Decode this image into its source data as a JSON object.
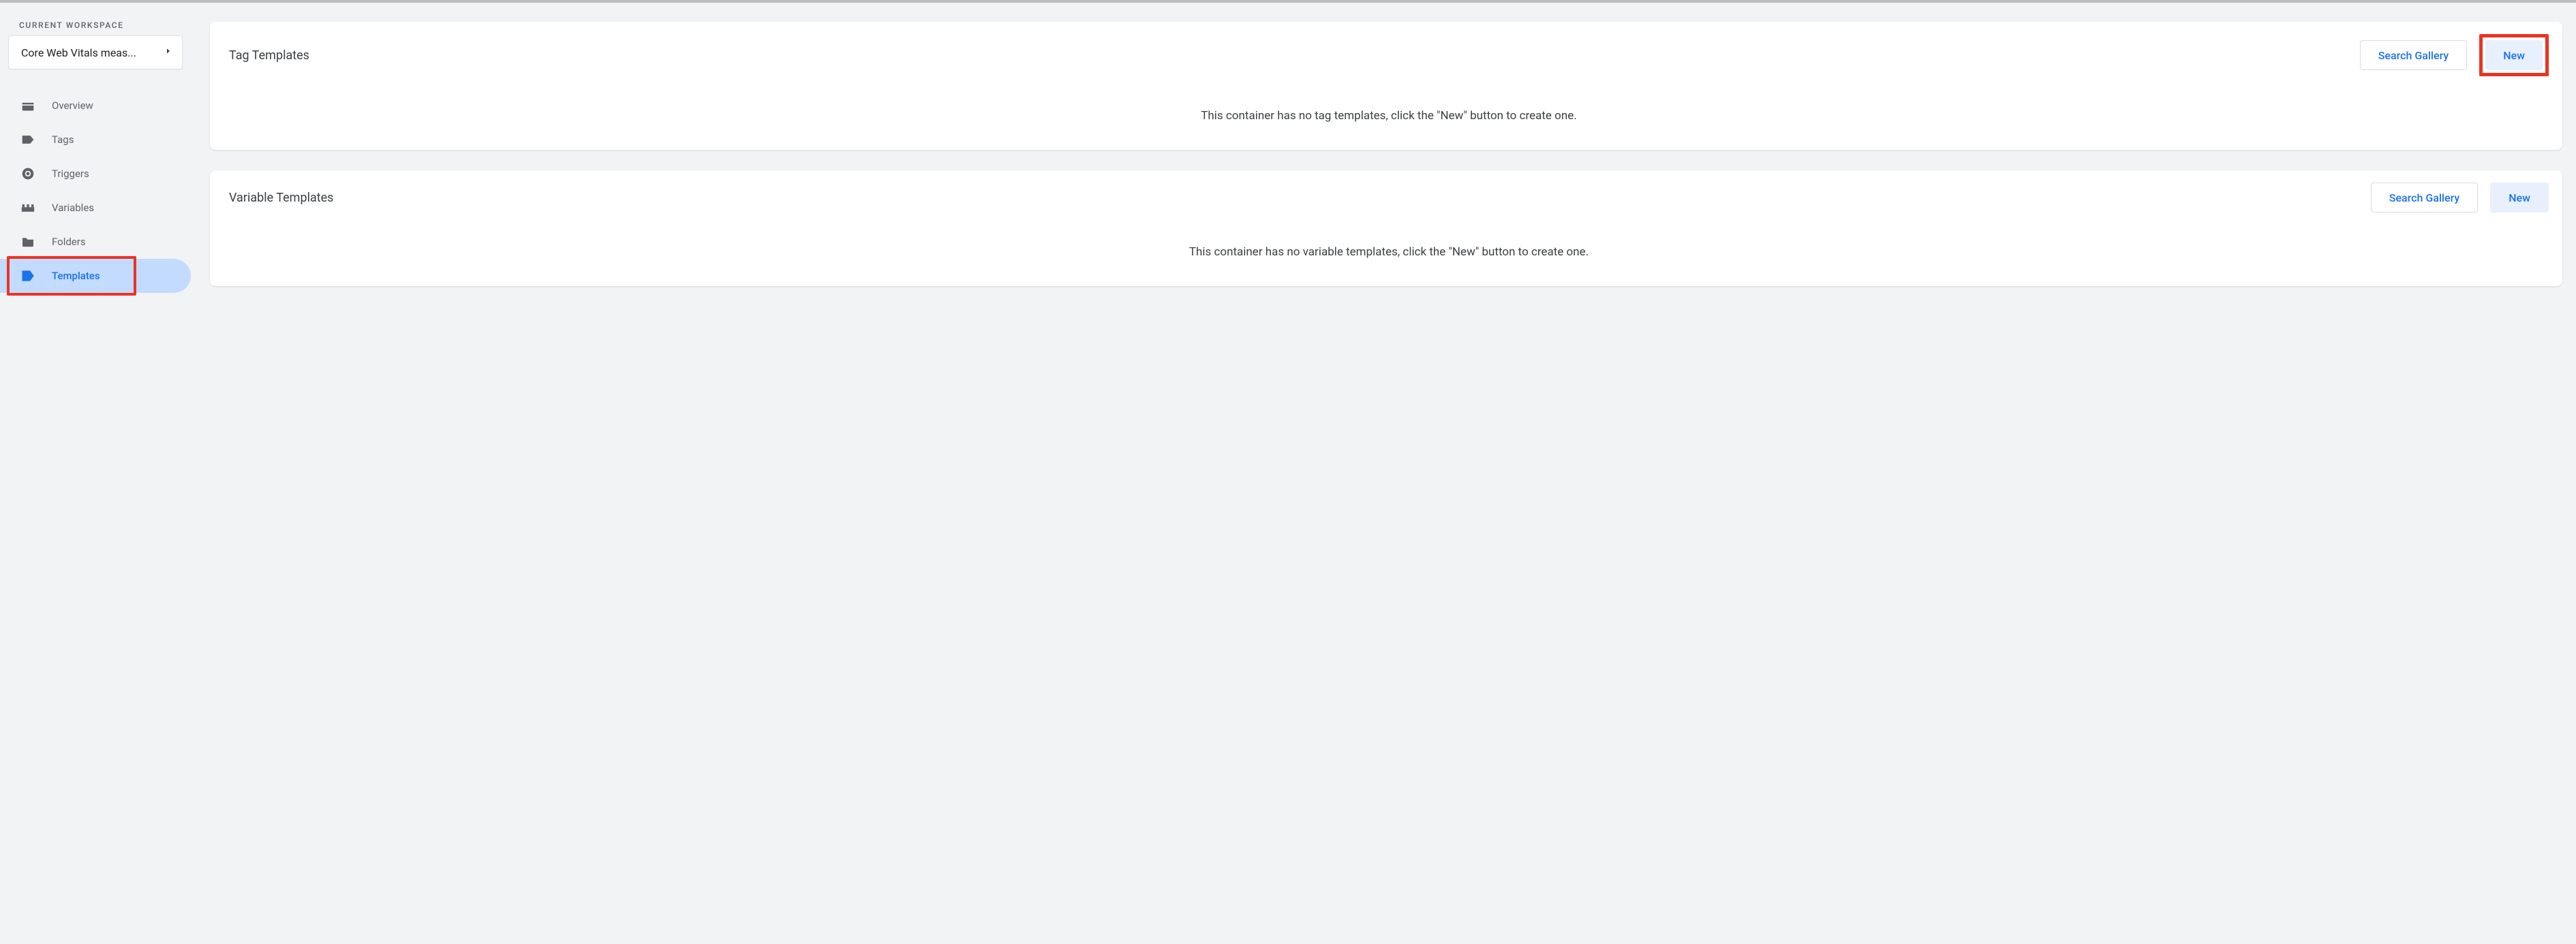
{
  "sidebar": {
    "workspace_label": "CURRENT WORKSPACE",
    "workspace_name": "Core Web Vitals meas...",
    "items": [
      {
        "label": "Overview",
        "icon": "dashboard-icon",
        "active": false
      },
      {
        "label": "Tags",
        "icon": "tag-icon",
        "active": false
      },
      {
        "label": "Triggers",
        "icon": "trigger-icon",
        "active": false
      },
      {
        "label": "Variables",
        "icon": "variables-icon",
        "active": false
      },
      {
        "label": "Folders",
        "icon": "folder-icon",
        "active": false
      },
      {
        "label": "Templates",
        "icon": "template-icon",
        "active": true
      }
    ]
  },
  "cards": {
    "tag_templates": {
      "title": "Tag Templates",
      "gallery_label": "Search Gallery",
      "new_label": "New",
      "empty_message": "This container has no tag templates, click the \"New\" button to create one."
    },
    "variable_templates": {
      "title": "Variable Templates",
      "gallery_label": "Search Gallery",
      "new_label": "New",
      "empty_message": "This container has no variable templates, click the \"New\" button to create one."
    }
  },
  "annotations": {
    "highlight_color": "#ec3323",
    "highlighted_sidebar_item": "Templates",
    "highlighted_button": "tag_templates.new"
  }
}
